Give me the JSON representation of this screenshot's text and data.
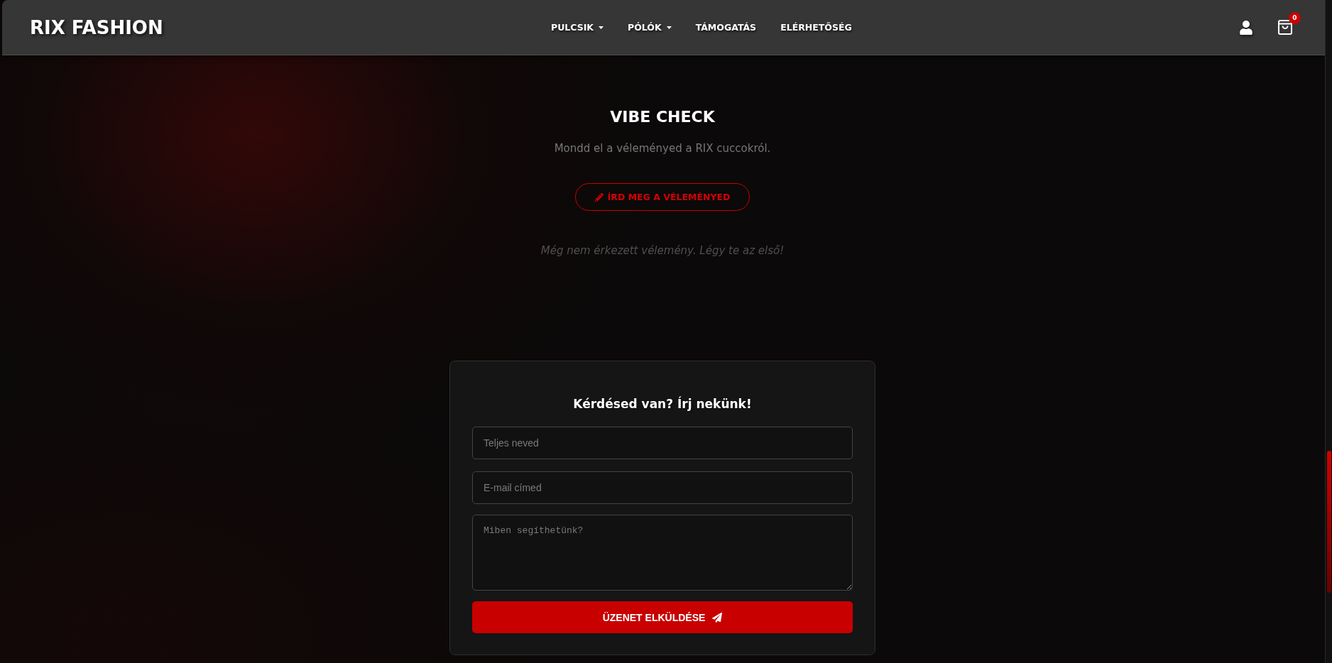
{
  "header": {
    "logo": "RIX FASHION",
    "nav": [
      {
        "label": "PULCSIK",
        "dropdown": true
      },
      {
        "label": "PÓLÓK",
        "dropdown": true
      },
      {
        "label": "TÁMOGATÁS",
        "dropdown": false
      },
      {
        "label": "ELÉRHETŐSÉG",
        "dropdown": false
      }
    ],
    "cart_count": "0"
  },
  "reviews": {
    "title": "VIBE CHECK",
    "subtitle": "Mondd el a véleményed a RIX cuccokról.",
    "button": "ÍRD MEG A VÉLEMÉNYED",
    "empty_text": "Még nem érkezett vélemény. Légy te az első!"
  },
  "contact_form": {
    "title": "Kérdésed van? Írj nekünk!",
    "fields": [
      {
        "kind": "text",
        "placeholder": "Teljes neved"
      },
      {
        "kind": "email",
        "placeholder": "E-mail címed"
      },
      {
        "kind": "textarea",
        "placeholder": "Miben segíthetünk?"
      }
    ],
    "submit": "ÜZENET ELKÜLDÉSE"
  }
}
